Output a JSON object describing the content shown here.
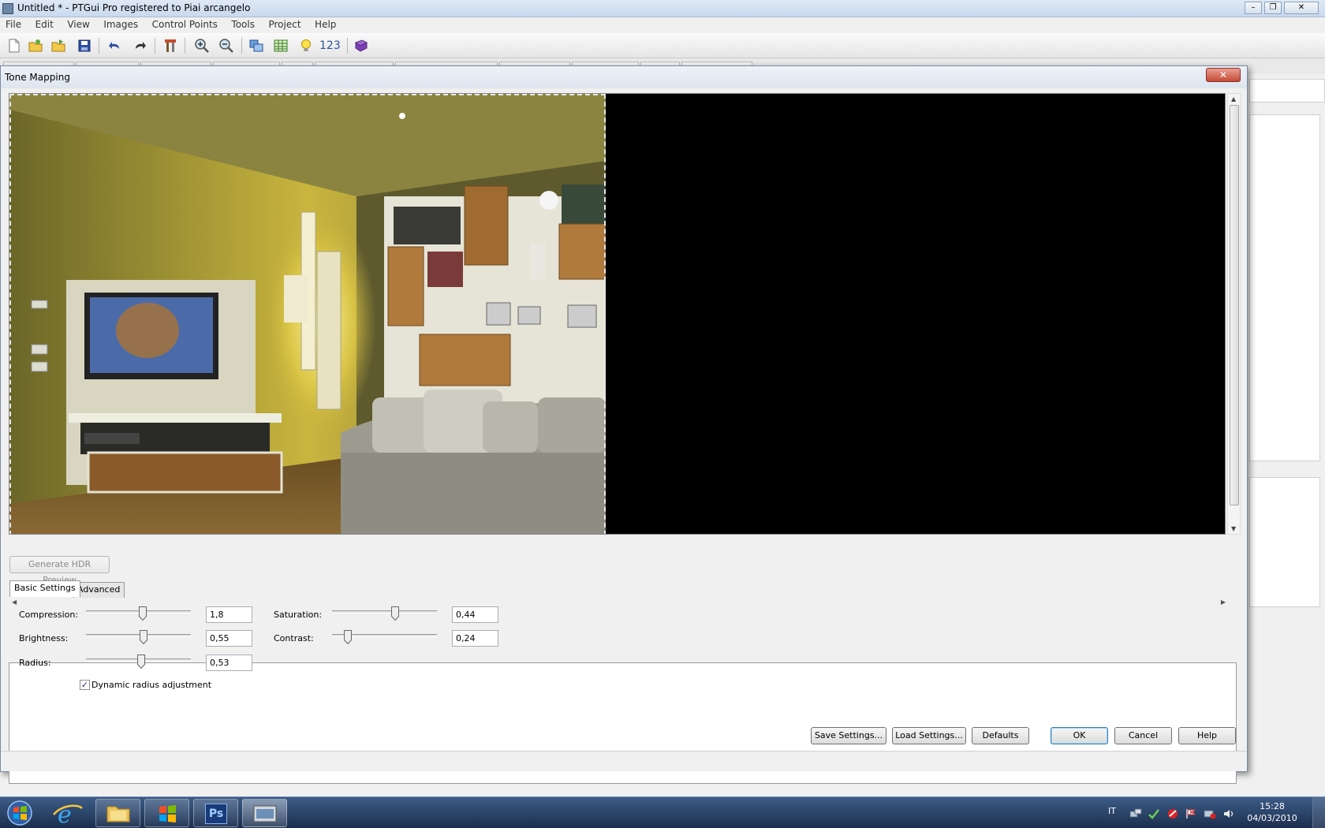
{
  "window": {
    "title": "Untitled * - PTGui Pro registered to Piai arcangelo",
    "minimize": "–",
    "restore": "❐",
    "close": "✕"
  },
  "menu": [
    "File",
    "Edit",
    "View",
    "Images",
    "Control Points",
    "Tools",
    "Project",
    "Help"
  ],
  "toolbar": {
    "icons": [
      "new-icon",
      "open-icon",
      "open-recent-icon",
      "save-icon",
      "undo-icon",
      "redo-icon",
      "tools-icon",
      "zoom-in-icon",
      "zoom-out-icon",
      "panorama-editor-icon",
      "table-icon",
      "lightbulb-icon",
      "numbers-icon",
      "help-book-icon"
    ],
    "numbers_label": "123"
  },
  "dialog": {
    "title": "Tone Mapping",
    "close": "✕",
    "generate_button": "Generate HDR Preview",
    "tabs": [
      "Basic Settings",
      "Advanced"
    ],
    "settings": {
      "compression": {
        "label": "Compression:",
        "value": "1,8",
        "level": 0.54
      },
      "brightness": {
        "label": "Brightness:",
        "value": "0,55",
        "level": 0.55
      },
      "radius": {
        "label": "Radius:",
        "value": "0,53",
        "level": 0.53
      },
      "saturation": {
        "label": "Saturation:",
        "value": "0,44",
        "level": 0.6
      },
      "contrast": {
        "label": "Contrast:",
        "value": "0,24",
        "level": 0.15
      }
    },
    "dynamic_radius": {
      "label": "Dynamic radius adjustment",
      "checked": true,
      "check": "✓"
    },
    "buttons": {
      "save": "Save Settings...",
      "load": "Load Settings...",
      "defaults": "Defaults",
      "ok": "OK",
      "cancel": "Cancel",
      "help": "Help"
    }
  },
  "taskbar": {
    "apps": [
      "internet-explorer-icon",
      "explorer-folder-icon",
      "windows-app-icon",
      "photoshop-icon",
      "ptgui-icon"
    ],
    "photoshop_label": "Ps",
    "language": "IT",
    "time": "15:28",
    "date": "04/03/2010"
  }
}
